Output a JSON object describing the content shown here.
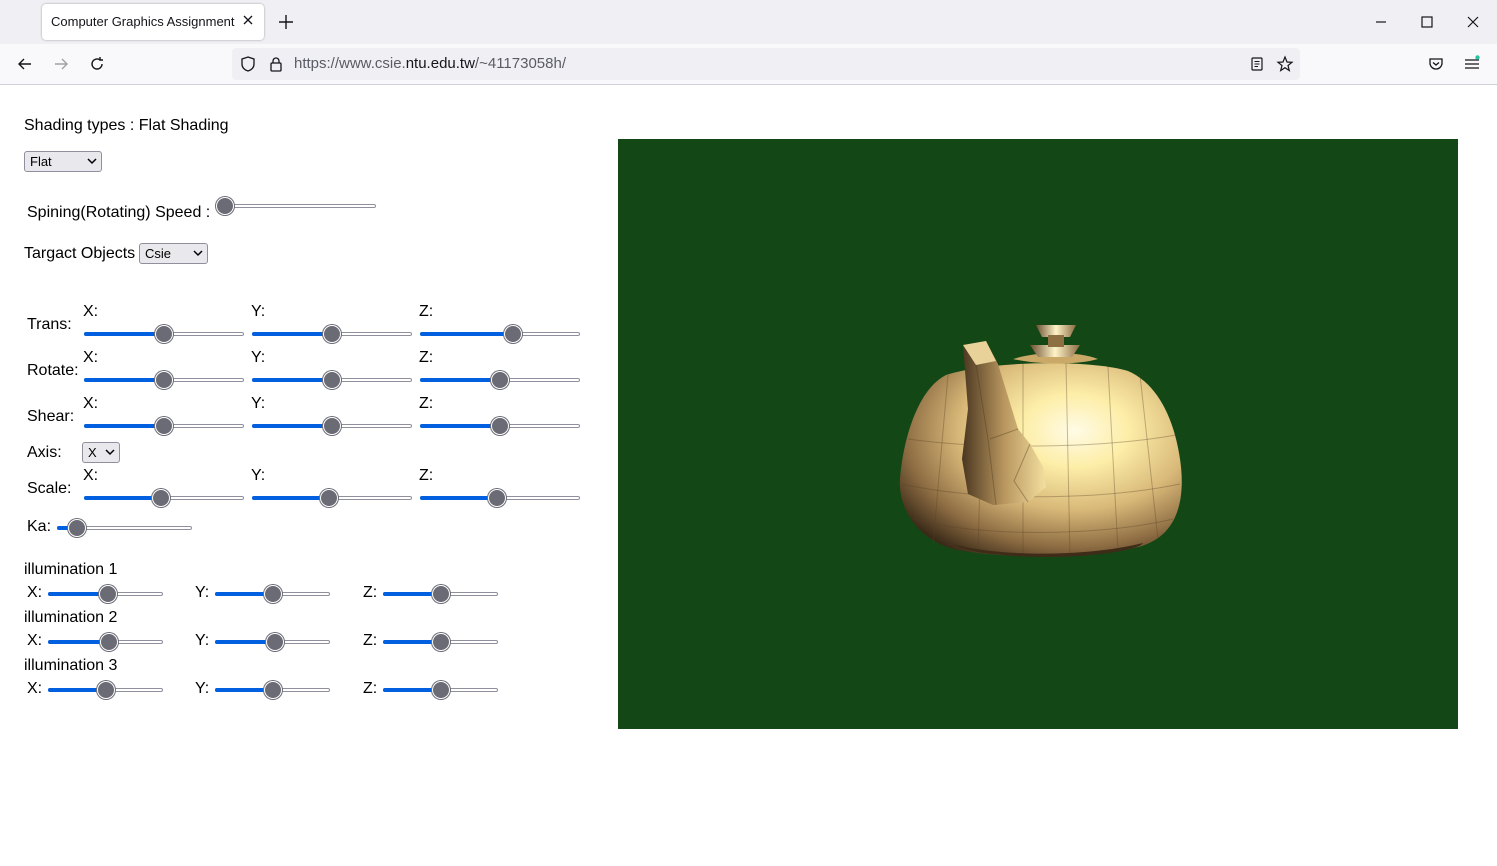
{
  "browser": {
    "tab_title": "Computer Graphics Assignment",
    "url_prefix": "https://www.csie.",
    "url_domain": "ntu.edu.tw",
    "url_path": "/~41173058h/"
  },
  "controls": {
    "shading_label": "Shading types : Flat Shading",
    "shading_select": "Flat",
    "speed_label": "Spining(Rotating) Speed :",
    "speed_value": 0.05,
    "target_label": "Targact Objects",
    "target_select": "Csie",
    "trans_label": "Trans:",
    "rotate_label": "Rotate:",
    "shear_label": "Shear:",
    "axis_label": "Axis:",
    "axis_select": "X",
    "scale_label": "Scale:",
    "ka_label": "Ka:",
    "ka_value": 0.15,
    "x_label": "X:",
    "y_label": "Y:",
    "z_label": "Z:",
    "illum1_label": "illumination 1",
    "illum2_label": "illumination 2",
    "illum3_label": "illumination 3"
  },
  "slider_values": {
    "trans": [
      0.5,
      0.5,
      0.58
    ],
    "rotate": [
      0.5,
      0.5,
      0.5
    ],
    "shear": [
      0.5,
      0.5,
      0.5
    ],
    "scale": [
      0.48,
      0.48,
      0.48
    ],
    "illum1": [
      0.52,
      0.5,
      0.5
    ],
    "illum2": [
      0.53,
      0.52,
      0.5
    ],
    "illum3": [
      0.5,
      0.5,
      0.5
    ]
  },
  "colors": {
    "canvas_bg": "#134716",
    "slider_fill": "#0060df",
    "thumb": "#6b6b76"
  }
}
